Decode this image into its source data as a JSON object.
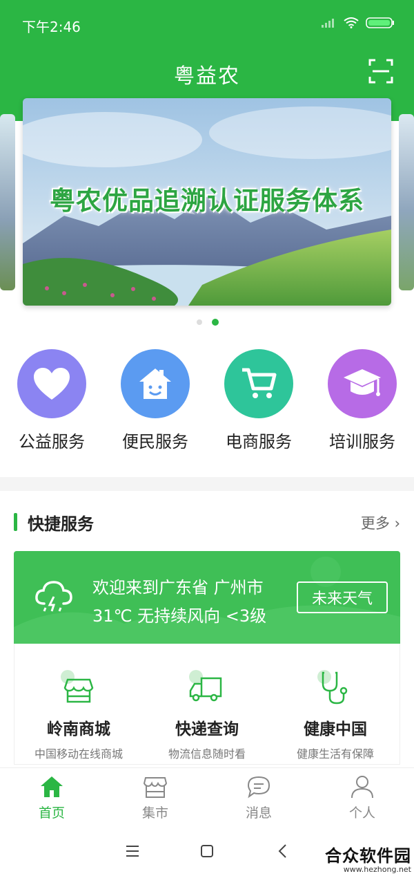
{
  "status_bar": {
    "time": "下午2:46"
  },
  "header": {
    "title": "粤益农"
  },
  "banner": {
    "text": "粤农优品追溯认证服务体系",
    "pages": 2,
    "active_page": 2
  },
  "services": [
    {
      "label": "公益服务",
      "icon": "heart-icon",
      "color": "#8b84f2"
    },
    {
      "label": "便民服务",
      "icon": "house-icon",
      "color": "#5b9bf1"
    },
    {
      "label": "电商服务",
      "icon": "cart-icon",
      "color": "#2ec59a"
    },
    {
      "label": "培训服务",
      "icon": "graduation-cap-icon",
      "color": "#b76be6"
    }
  ],
  "quick_section": {
    "title": "快捷服务",
    "more": "更多"
  },
  "weather": {
    "line1": "欢迎来到广东省 广州市",
    "line2": "31℃ 无持续风向 <3级",
    "button": "未来天气"
  },
  "quick_items": [
    {
      "title": "岭南商城",
      "subtitle": "中国移动在线商城",
      "icon": "store-icon"
    },
    {
      "title": "快递查询",
      "subtitle": "物流信息随时看",
      "icon": "truck-icon"
    },
    {
      "title": "健康中国",
      "subtitle": "健康生活有保障",
      "icon": "stethoscope-icon"
    }
  ],
  "tabs": [
    {
      "label": "首页",
      "icon": "home-icon",
      "active": true
    },
    {
      "label": "集市",
      "icon": "market-icon",
      "active": false
    },
    {
      "label": "消息",
      "icon": "message-icon",
      "active": false
    },
    {
      "label": "个人",
      "icon": "person-icon",
      "active": false
    }
  ],
  "watermark": {
    "name": "合众软件园",
    "url": "www.hezhong.net"
  },
  "colors": {
    "brand": "#2bb644"
  }
}
